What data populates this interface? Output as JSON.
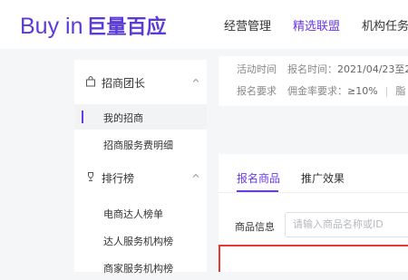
{
  "header": {
    "logo_text": "Buy in",
    "logo_cn": "巨量百应",
    "nav": [
      {
        "label": "经营管理",
        "active": false
      },
      {
        "label": "精选联盟",
        "active": true
      },
      {
        "label": "机构任务",
        "active": false
      }
    ]
  },
  "sidebar": {
    "groups": [
      {
        "label": "招商团长",
        "icon": "shopping-bag-icon",
        "expanded": true,
        "items": [
          {
            "label": "我的招商",
            "active": true
          },
          {
            "label": "招商服务费明细",
            "active": false
          }
        ]
      },
      {
        "label": "排行榜",
        "icon": "trophy-icon",
        "expanded": true,
        "items": [
          {
            "label": "电商达人榜单",
            "active": false
          },
          {
            "label": "达人服务机构榜",
            "active": false
          },
          {
            "label": "商家服务机构榜",
            "active": false
          }
        ]
      }
    ]
  },
  "info": {
    "row1": {
      "label1": "活动时间",
      "label2": "报名时间：",
      "value2": "2021/04/23至2"
    },
    "row2": {
      "label1": "报名要求",
      "label2": "佣金率要求：",
      "value2": "≥10%",
      "trailing": "脂"
    }
  },
  "main": {
    "tabs": [
      {
        "label": "报名商品",
        "active": true
      },
      {
        "label": "推广效果",
        "active": false
      }
    ],
    "filter": {
      "label": "商品信息",
      "placeholder": "请输入商品名称或ID",
      "value": ""
    }
  },
  "colors": {
    "brand": "#5b3ad6",
    "accent": "#6a3be0",
    "highlight": "#e53935"
  }
}
